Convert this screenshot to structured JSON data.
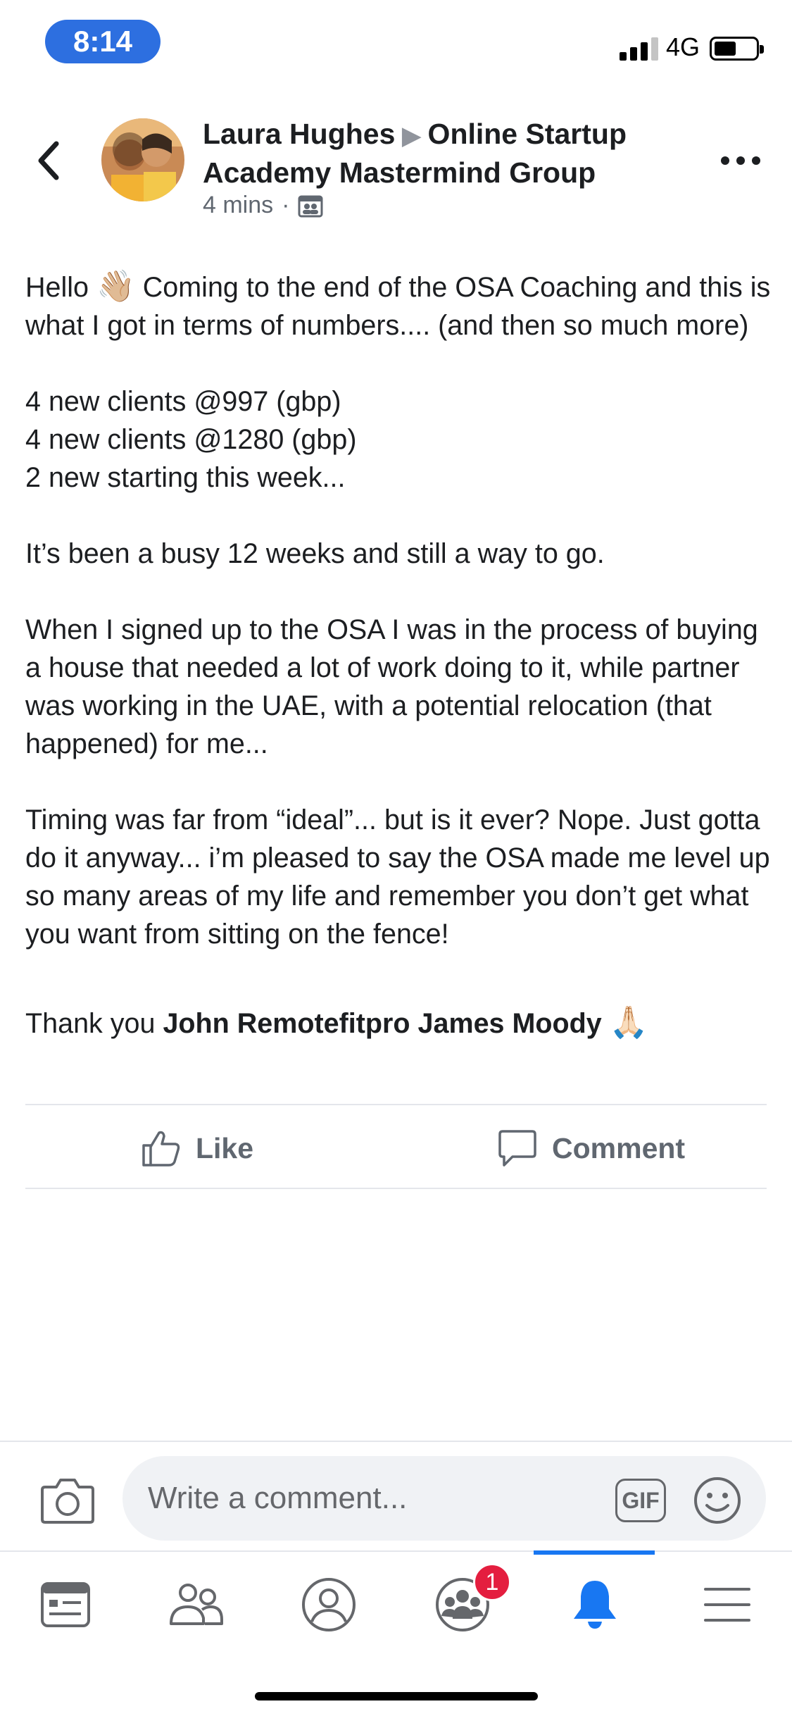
{
  "status_bar": {
    "time": "8:14",
    "network": "4G"
  },
  "header": {
    "author": "Laura Hughes",
    "group": "Online Startup Academy Mastermind Group",
    "timestamp": "4 mins",
    "separator": "·",
    "icons": {
      "back": "chevron-left-icon",
      "privacy": "group-audience-icon",
      "more": "more-options-icon"
    }
  },
  "post": {
    "line1_prefix": "Hello",
    "wave_emoji": "👋🏼",
    "line1_suffix": "Coming to the end of the OSA Coaching and this is what I got in terms of numbers.... (and then so much more)",
    "stats": [
      "4 new clients @997 (gbp)",
      "4 new clients @1280 (gbp)",
      "2 new starting this week..."
    ],
    "para2": "It’s been a busy 12 weeks and still a way to go.",
    "para3": "When I signed up to the OSA I was in the process of buying a house that needed a lot of work doing to it, while partner was working in the UAE, with a potential relocation (that happened) for me...",
    "para4": "Timing was far from “ideal”... but is it ever? Nope. Just gotta do it anyway... i’m pleased to say the OSA made me level up so many areas of my life and remember you don’t get what you want from sitting on the fence!",
    "thanks_prefix": "Thank you",
    "thanks_mention": "John Remotefitpro James Moody",
    "pray_emoji": "🙏🏻"
  },
  "actions": {
    "like": "Like",
    "comment": "Comment"
  },
  "comment_bar": {
    "placeholder": "Write a comment...",
    "gif": "GIF"
  },
  "tab_bar": {
    "items": [
      "news-feed-icon",
      "friends-icon",
      "profile-icon",
      "groups-icon",
      "notifications-icon",
      "menu-icon"
    ],
    "groups_badge": "1",
    "active": "notifications"
  },
  "colors": {
    "accent": "#1877f2",
    "time_pill": "#2d6fe0",
    "badge": "#e41e3f",
    "muted_text": "#606770"
  }
}
